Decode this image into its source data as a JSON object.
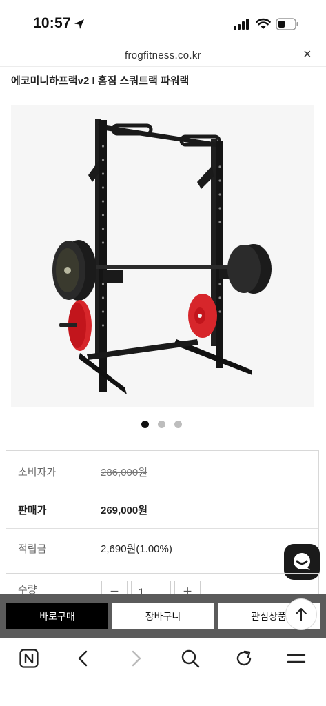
{
  "status_bar": {
    "time": "10:57"
  },
  "browser": {
    "url": "frogfitness.co.kr",
    "close_label": "×"
  },
  "product": {
    "title": "에코미니하프랙v2 l 홈짐 스쿼트랙 파워랙",
    "image_count": 3,
    "active_image_index": 0
  },
  "pricing": {
    "retail_label": "소비자가",
    "retail_price": "286,000원",
    "sale_label": "판매가",
    "sale_price": "269,000원",
    "points_label": "적립금",
    "points_value": "2,690원(1.00%)"
  },
  "quantity": {
    "label": "수량",
    "value": "1",
    "minus": "−",
    "plus": "+"
  },
  "actions": {
    "buy_now": "바로구매",
    "cart": "장바구니",
    "wishlist": "관심상품"
  },
  "colors": {
    "buy_bg": "#000000",
    "action_bar_bg": "#5b5b5b",
    "plate_red": "#d7262b",
    "rack_black": "#1a1a1a"
  },
  "icons": {
    "location": "location-arrow-icon",
    "signal": "cellular-signal-icon",
    "wifi": "wifi-icon",
    "battery": "battery-icon",
    "chat": "chat-icon",
    "scroll_top": "arrow-up-icon",
    "nav": [
      "naver-home-icon",
      "back-icon",
      "forward-icon",
      "search-icon",
      "refresh-icon",
      "menu-icon"
    ]
  }
}
